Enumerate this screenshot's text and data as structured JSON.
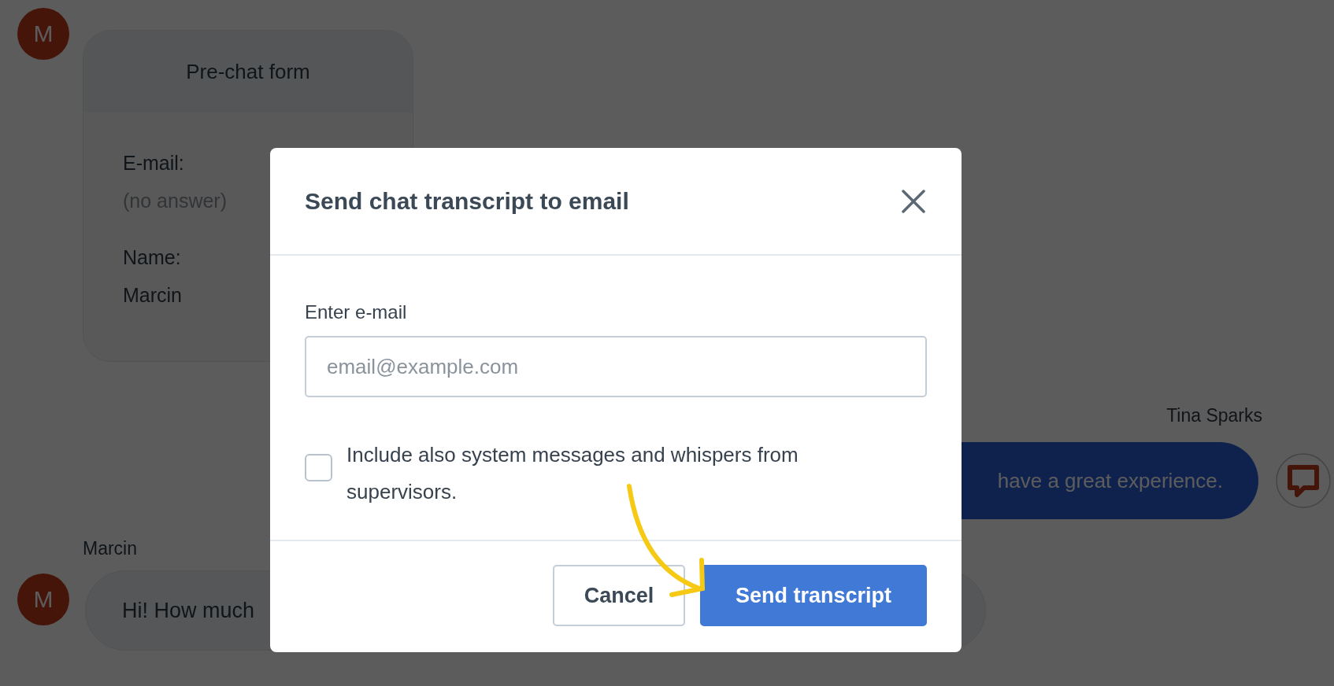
{
  "chat": {
    "prechat_form": {
      "avatar": "M",
      "title": "Pre-chat form",
      "fields": [
        {
          "label": "E-mail:",
          "value": "(no answer)",
          "answered": false
        },
        {
          "label": "Name:",
          "value": "Marcin",
          "answered": true
        }
      ]
    },
    "agent_message": {
      "sender": "Tina Sparks",
      "text": "have a great experience."
    },
    "visitor_message": {
      "sender": "Marcin",
      "avatar": "M",
      "text": "Hi! How much"
    }
  },
  "dialog": {
    "title": "Send chat transcript to email",
    "email_field": {
      "label": "Enter e-mail",
      "placeholder": "email@example.com"
    },
    "checkbox": {
      "label": "Include also system messages and whispers from supervisors.",
      "checked": false
    },
    "buttons": [
      {
        "label": "Cancel",
        "kind": "secondary"
      },
      {
        "label": "Send transcript",
        "kind": "primary"
      }
    ]
  }
}
